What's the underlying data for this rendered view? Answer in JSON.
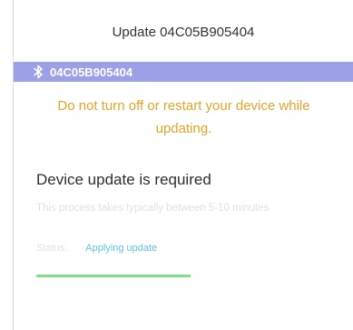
{
  "header": {
    "title": "Update 04C05B905404"
  },
  "device_bar": {
    "icon": "bluetooth-icon",
    "device_id": "04C05B905404",
    "background": "#9ba0e7"
  },
  "warning": {
    "text": "Do not turn off or restart your device while updating.",
    "color": "#e7a229"
  },
  "update": {
    "heading": "Device update is required",
    "subtext": "This process takes typically between 5-10 minutes",
    "status_label": "Status:",
    "status_value": "Applying update",
    "status_color": "#5fc1ea",
    "progress_fraction": 1.0,
    "progress_color": "#7ee08a"
  }
}
